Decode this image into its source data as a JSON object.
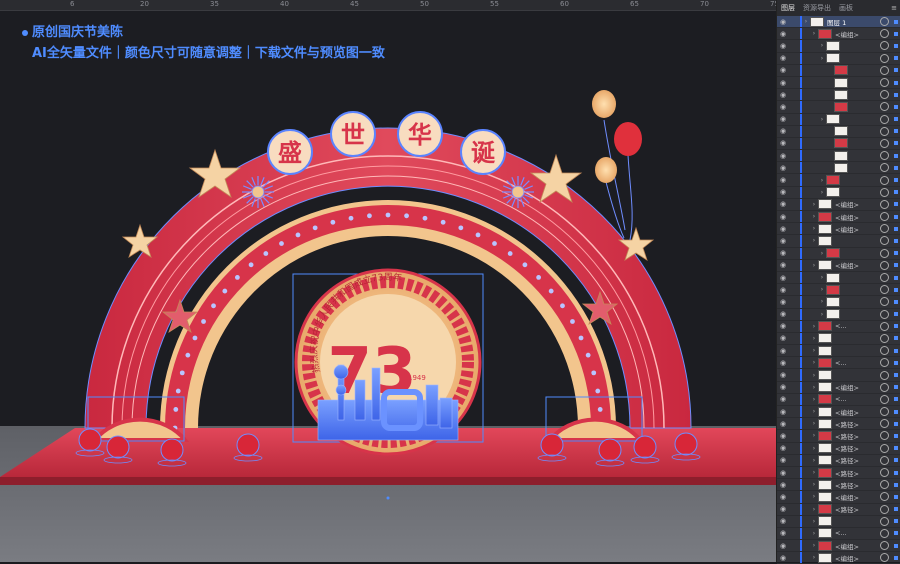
{
  "ruler": {
    "ticks": [
      "6",
      "20",
      "35",
      "40",
      "45",
      "50",
      "55",
      "60",
      "65",
      "70",
      "75"
    ]
  },
  "headline": {
    "line1": "原创国庆节美陈",
    "line2": "AI全矢量文件｜颜色尺寸可随意调整｜下载文件与预览图一致"
  },
  "arch": {
    "chars": [
      "盛",
      "世",
      "华",
      "诞"
    ],
    "badge_text": "热烈庆祝中华人民共和国成立73周年",
    "number": "73",
    "small_year": "1949",
    "colors": {
      "red": "#d7344a",
      "gold": "#f2c58d",
      "blue": "#5b84ff"
    }
  },
  "panel": {
    "tabs": [
      "图层",
      "资源导出",
      "画板"
    ],
    "layers": [
      {
        "name": "图层 1",
        "indent": 0,
        "top": true
      },
      {
        "name": "<编组>",
        "indent": 1
      },
      {
        "name": "",
        "indent": 2
      },
      {
        "name": "",
        "indent": 2
      },
      {
        "name": "",
        "indent": 3
      },
      {
        "name": "",
        "indent": 3
      },
      {
        "name": "",
        "indent": 3
      },
      {
        "name": "",
        "indent": 3
      },
      {
        "name": "",
        "indent": 2
      },
      {
        "name": "",
        "indent": 3
      },
      {
        "name": "",
        "indent": 3
      },
      {
        "name": "",
        "indent": 3
      },
      {
        "name": "",
        "indent": 3
      },
      {
        "name": "",
        "indent": 2
      },
      {
        "name": "",
        "indent": 2
      },
      {
        "name": "<编组>",
        "indent": 1
      },
      {
        "name": "<编组>",
        "indent": 1
      },
      {
        "name": "<编组>",
        "indent": 1
      },
      {
        "name": "",
        "indent": 1
      },
      {
        "name": "",
        "indent": 2
      },
      {
        "name": "<编组>",
        "indent": 1
      },
      {
        "name": "",
        "indent": 2
      },
      {
        "name": "",
        "indent": 2
      },
      {
        "name": "",
        "indent": 2
      },
      {
        "name": "",
        "indent": 2
      },
      {
        "name": "<...",
        "indent": 1
      },
      {
        "name": "",
        "indent": 1
      },
      {
        "name": "",
        "indent": 1
      },
      {
        "name": "<...",
        "indent": 1
      },
      {
        "name": "",
        "indent": 1
      },
      {
        "name": "<编组>",
        "indent": 1
      },
      {
        "name": "<...",
        "indent": 1
      },
      {
        "name": "<编组>",
        "indent": 1
      },
      {
        "name": "<路径>",
        "indent": 1
      },
      {
        "name": "<路径>",
        "indent": 1
      },
      {
        "name": "<路径>",
        "indent": 1
      },
      {
        "name": "<路径>",
        "indent": 1
      },
      {
        "name": "<路径>",
        "indent": 1
      },
      {
        "name": "<路径>",
        "indent": 1
      },
      {
        "name": "<编组>",
        "indent": 1
      },
      {
        "name": "<路径>",
        "indent": 1
      },
      {
        "name": "",
        "indent": 1
      },
      {
        "name": "<...",
        "indent": 1
      },
      {
        "name": "<编组>",
        "indent": 1
      },
      {
        "name": "<编组>",
        "indent": 1
      }
    ]
  }
}
